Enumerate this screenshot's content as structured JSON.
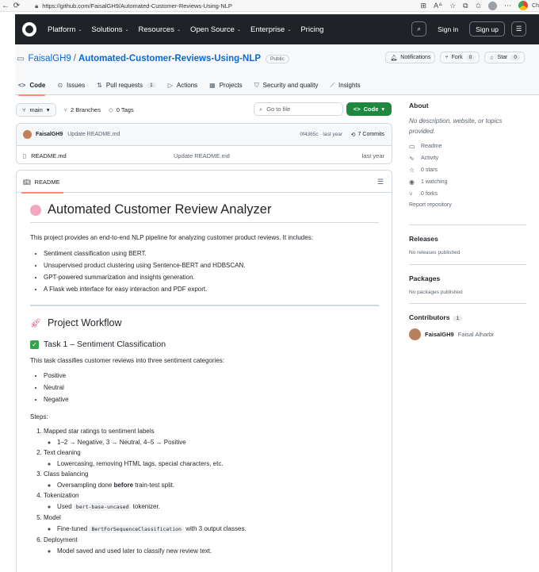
{
  "browser": {
    "url": "https://github.com/FaisalGH9/Automated-Customer-Reviews-Using-NLP",
    "profile_text": "Ch"
  },
  "header": {
    "nav": [
      "Platform",
      "Solutions",
      "Resources",
      "Open Source",
      "Enterprise",
      "Pricing"
    ],
    "sign_in": "Sign in",
    "sign_up": "Sign up"
  },
  "repo": {
    "owner": "FaisalGH9",
    "separator": "/",
    "name": "Automated-Customer-Reviews-Using-NLP",
    "visibility": "Public",
    "notifications": "Notifications",
    "fork_label": "Fork",
    "fork_count": "0",
    "star_label": "Star",
    "star_count": "0",
    "tabs": [
      {
        "label": "Code",
        "icon": "code-icon"
      },
      {
        "label": "Issues",
        "icon": "issue-icon"
      },
      {
        "label": "Pull requests",
        "icon": "pull-request-icon",
        "count": "1"
      },
      {
        "label": "Actions",
        "icon": "play-icon"
      },
      {
        "label": "Projects",
        "icon": "table-icon"
      },
      {
        "label": "Security and quality",
        "icon": "shield-icon"
      },
      {
        "label": "Insights",
        "icon": "graph-icon"
      }
    ]
  },
  "codebar": {
    "branch": "main",
    "branches": "2 Branches",
    "tags": "0 Tags",
    "goto_placeholder": "Go to file",
    "code_button": "Code"
  },
  "commit": {
    "author": "FaisalGH9",
    "message": "Update README.md",
    "hash_time": "0f4365c · last year",
    "commits": "7 Commits"
  },
  "files": [
    {
      "name": "README.md",
      "message": "Update README.md",
      "age": "last year"
    }
  ],
  "readme": {
    "tab": "README",
    "title": "Automated Customer Review Analyzer",
    "intro": "This project provides an end-to-end NLP pipeline for analyzing customer product reviews. It includes:",
    "features": [
      "Sentiment classification using BERT.",
      "Unsupervised product clustering using Sentence-BERT and HDBSCAN.",
      "GPT-powered summarization and insights generation.",
      "A Flask web interface for easy interaction and PDF export."
    ],
    "workflow_title": "Project Workflow",
    "task1_title": "Task 1 – Sentiment Classification",
    "task1_intro": "This task classifies customer reviews into three sentiment categories:",
    "categories": [
      "Positive",
      "Neutral",
      "Negative"
    ],
    "steps_label": "Steps:",
    "steps": [
      {
        "title": "Mapped star ratings to sentiment labels",
        "detail": "1–2 → Negative, 3 → Neutral, 4–5 → Positive"
      },
      {
        "title": "Text cleaning",
        "detail": "Lowercasing, removing HTML tags, special characters, etc."
      },
      {
        "title": "Class balancing",
        "detail_pre": "Oversampling done ",
        "detail_bold": "before",
        "detail_post": " train-test split."
      },
      {
        "title": "Tokenization",
        "detail_pre": "Used ",
        "detail_code": "bert-base-uncased",
        "detail_post": " tokenizer."
      },
      {
        "title": "Model",
        "detail_pre": "Fine-tuned ",
        "detail_code": "BertForSequenceClassification",
        "detail_post": " with 3 output classes."
      },
      {
        "title": "Deployment",
        "detail": "Model saved and used later to classify new review text."
      }
    ]
  },
  "sidebar": {
    "about_title": "About",
    "about_desc": "No description, website, or topics provided.",
    "items": [
      {
        "icon": "book-icon",
        "label": "Readme"
      },
      {
        "icon": "pulse-icon",
        "label": "Activity"
      },
      {
        "icon": "star-icon",
        "label": "0 stars"
      },
      {
        "icon": "eye-icon",
        "label": "1 watching"
      },
      {
        "icon": "fork-icon",
        "label": "0 forks"
      }
    ],
    "report": "Report repository",
    "releases_title": "Releases",
    "releases_text": "No releases published",
    "packages_title": "Packages",
    "packages_text": "No packages published",
    "contributors_title": "Contributors",
    "contributors_count": "1",
    "contributor_login": "FaisalGH9",
    "contributor_name": "Faisal Alharbi"
  },
  "colors": {
    "header_bg": "#1f2328",
    "link": "#0969da",
    "code_button": "#1f883d",
    "tab_underline": "#fd8c73"
  }
}
